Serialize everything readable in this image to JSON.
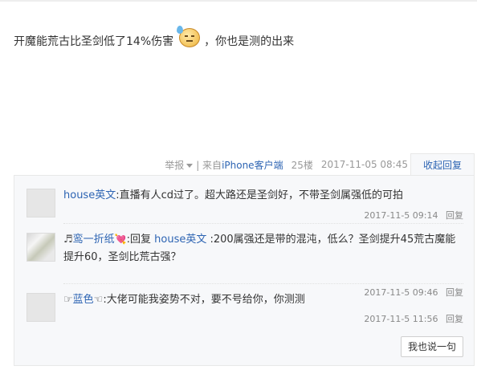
{
  "post": {
    "text_before": "开魔能荒古比圣剑低了14%伤害",
    "emoji": "sweat-smile-emoji",
    "text_after": "，你也是测的出来"
  },
  "meta": {
    "report": "举报",
    "source_prefix": "| 来自",
    "client": "iPhone客户端",
    "floor": "25楼",
    "datetime": "2017-11-05 08:45",
    "collapse_reply": "收起回复"
  },
  "replies": [
    {
      "user": "house英文",
      "text": ":直播有人cd过了。超大路还是圣剑好，不带圣剑属强低的可拍",
      "time": "2017-11-5 09:14",
      "reply_label": "回复"
    },
    {
      "user_prefix": "♬",
      "user": "鸾一折纸",
      "user_suffix": "💘",
      "text_lead": ":回复 ",
      "mention": "house英文",
      "text": " :200属强还是带的混沌，低么？圣剑提升45荒古魔能提升60，圣剑比荒古强？",
      "time": "2017-11-5 09:46",
      "reply_label": "回复"
    },
    {
      "user_prefix": "☞",
      "user": "蓝色",
      "user_suffix": "☜",
      "text": ":大佬可能我姿势不对，要不号给你，你测测",
      "time": "2017-11-5 11:56",
      "reply_label": "回复"
    }
  ],
  "say_button": "我也说一句",
  "colors": {
    "link": "#2d64b3",
    "box_bg": "#f7f8fa"
  }
}
